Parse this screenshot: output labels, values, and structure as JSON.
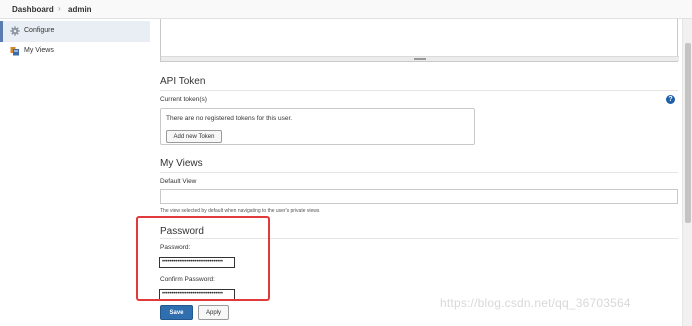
{
  "breadcrumb": {
    "home": "Dashboard",
    "separator": "›",
    "user": "admin"
  },
  "sidebar": {
    "items": [
      {
        "label": "Configure",
        "icon": "gear-icon",
        "active": true
      },
      {
        "label": "My Views",
        "icon": "views-icon",
        "active": false
      }
    ]
  },
  "api_token": {
    "title": "API Token",
    "current_label": "Current token(s)",
    "empty_message": "There are no registered tokens for this user.",
    "add_button": "Add new Token",
    "help_glyph": "?"
  },
  "my_views": {
    "title": "My Views",
    "default_view_label": "Default View",
    "default_view_value": "",
    "hint": "The view selected by default when navigating to the user's private views"
  },
  "password": {
    "title": "Password",
    "password_label": "Password:",
    "password_value": "••••••••••••••••••••••••••••••••",
    "confirm_label": "Confirm Password:",
    "confirm_value": "••••••••••••••••••••••••••••••••"
  },
  "actions": {
    "save": "Save",
    "apply": "Apply"
  },
  "watermark": "https://blog.csdn.net/qq_36703564",
  "colors": {
    "accent": "#2f6fb0",
    "highlight_box": "#e23a3a",
    "sidebar_active": "#e9eef4"
  }
}
